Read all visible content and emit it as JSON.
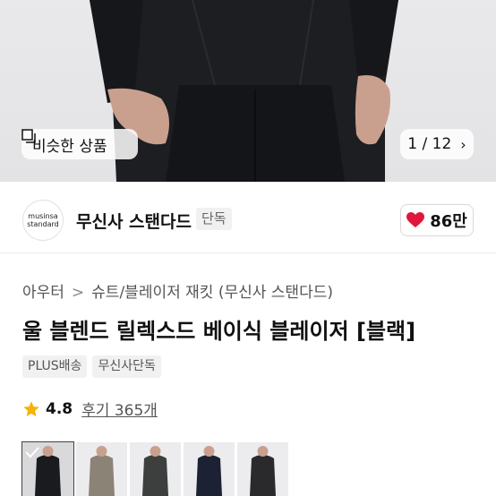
{
  "hero": {
    "similar_label": "비슷한 상품",
    "counter": "1 / 12",
    "icons": {
      "similar": "similar-product-icon",
      "next": "chevron-right-icon"
    }
  },
  "brand": {
    "logo_line1": "musinsa",
    "logo_line2": "standard",
    "name": "무신사 스탠다드",
    "badge": "단독",
    "likes": "86만"
  },
  "breadcrumb": [
    "아우터",
    "슈트/블레이저 재킷 (무신사 스탠다드)"
  ],
  "breadcrumb_sep": ">",
  "product": {
    "title": "울 블렌드 릴렉스드 베이식 블레이저 [블랙]",
    "tags": [
      "PLUS배송",
      "무신사단독"
    ]
  },
  "rating": {
    "score": "4.8",
    "reviews": "후기 365개"
  },
  "colors": {
    "accent_red": "#e0163d",
    "star": "#f5b400"
  },
  "color_thumbs": [
    "black",
    "beige",
    "charcoal",
    "navy",
    "dark-grey"
  ]
}
